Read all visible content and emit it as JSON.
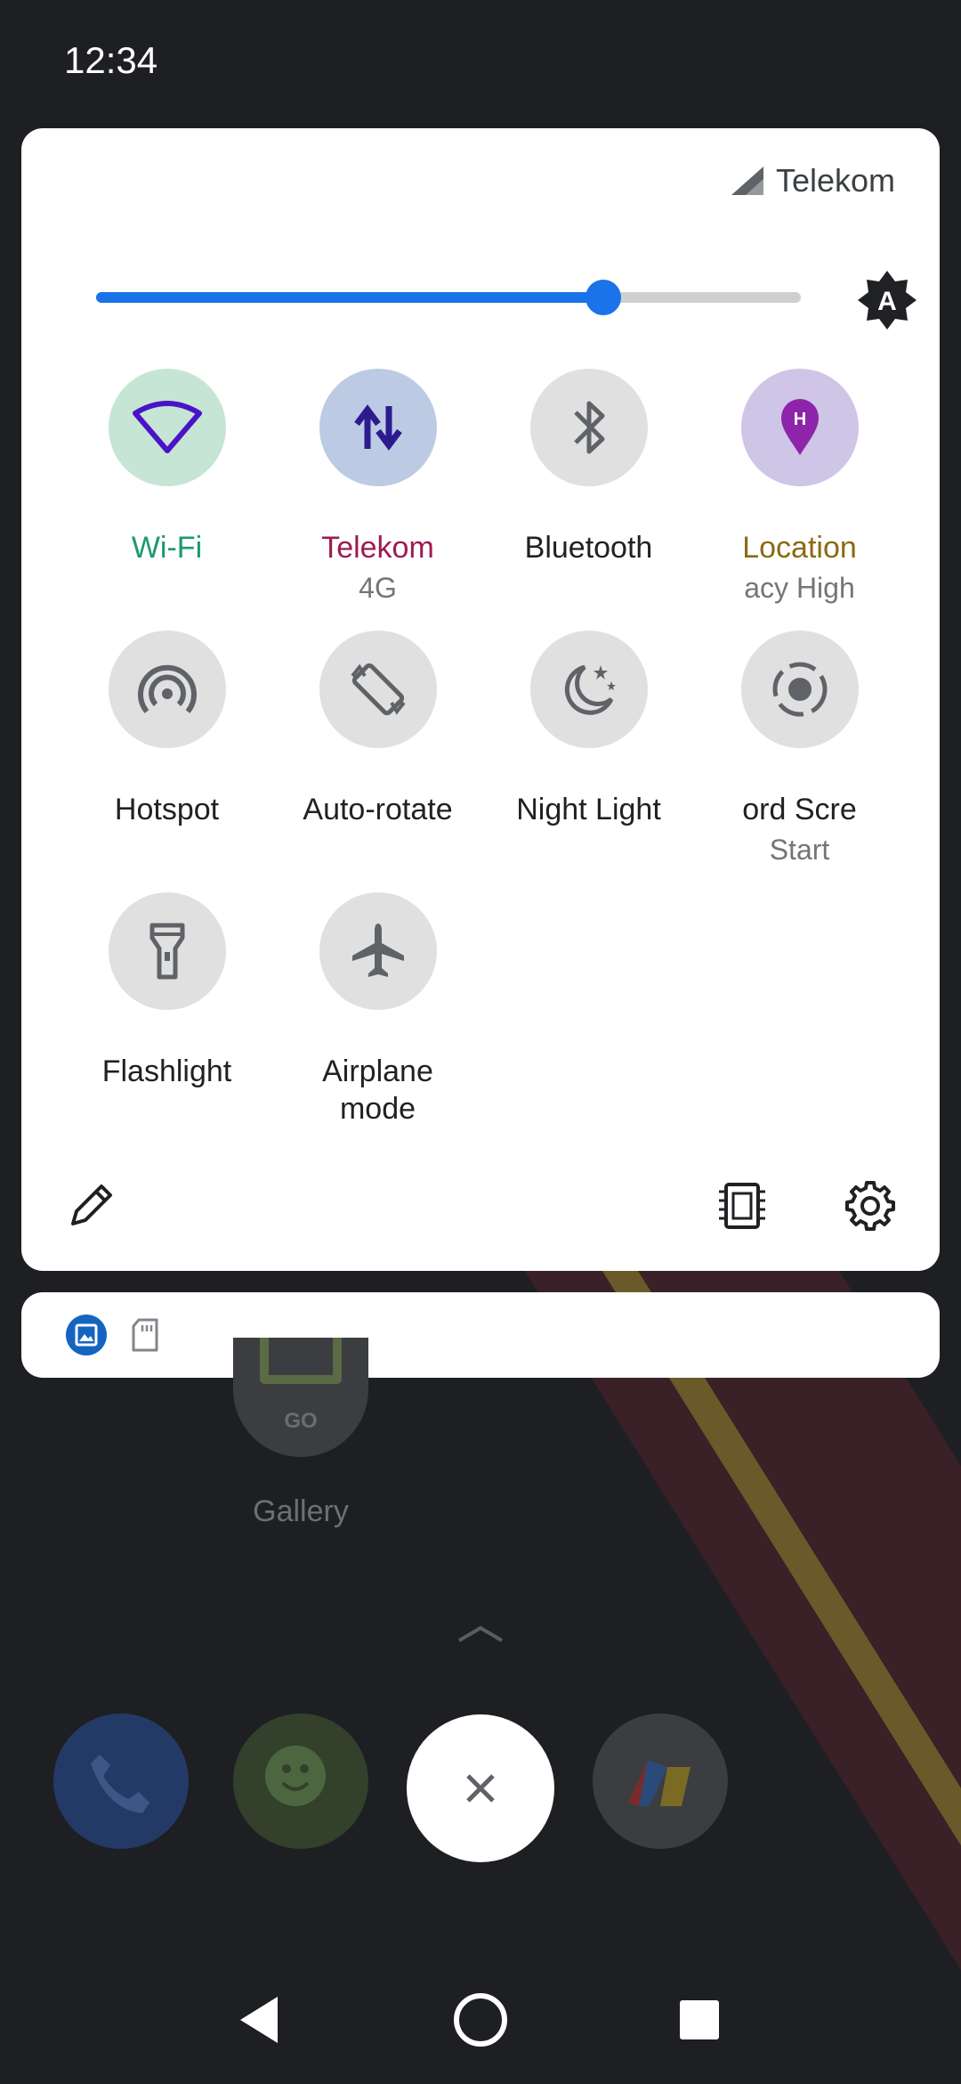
{
  "status_bar": {
    "time": "12:34"
  },
  "carrier": {
    "name": "Telekom"
  },
  "brightness": {
    "level": 0.72,
    "auto_label": "A"
  },
  "tiles": [
    {
      "id": "wifi",
      "label": "Wi-Fi",
      "sub": "",
      "icon": "wifi-icon",
      "active": true,
      "label_color": "#1a9a6c",
      "bg": "#c6e5d5"
    },
    {
      "id": "data",
      "label": "Telekom",
      "sub": "4G",
      "icon": "mobile-data-icon",
      "active": true,
      "label_color": "#9c1b53",
      "bg": "#bccbe3"
    },
    {
      "id": "bluetooth",
      "label": "Bluetooth",
      "sub": "",
      "icon": "bluetooth-icon",
      "active": false
    },
    {
      "id": "location",
      "label": "Location",
      "sub": "acy High",
      "icon": "location-icon",
      "active": true,
      "label_color": "#8a6b12",
      "bg": "#cfc5e6"
    },
    {
      "id": "hotspot",
      "label": "Hotspot",
      "sub": "",
      "icon": "hotspot-icon",
      "active": false
    },
    {
      "id": "rotate",
      "label": "Auto-rotate",
      "sub": "",
      "icon": "auto-rotate-icon",
      "active": false
    },
    {
      "id": "night",
      "label": "Night Light",
      "sub": "",
      "icon": "night-light-icon",
      "active": false
    },
    {
      "id": "record",
      "label": "ord Scre",
      "sub": "Start",
      "icon": "screen-record-icon",
      "active": false
    },
    {
      "id": "flashlight",
      "label": "Flashlight",
      "sub": "",
      "icon": "flashlight-icon",
      "active": false
    },
    {
      "id": "airplane",
      "label": "Airplane mode",
      "sub": "",
      "icon": "airplane-icon",
      "active": false
    }
  ],
  "home": {
    "gallery_label": "Gallery",
    "gallery_badge": "GO"
  }
}
